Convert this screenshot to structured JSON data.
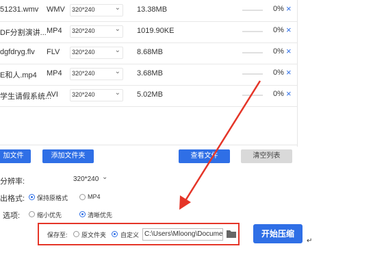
{
  "files": [
    {
      "name": "51231.wmv",
      "format": "WMV",
      "resolution": "320*240",
      "size": "13.38MB",
      "progress": 0,
      "progress_text": "0%"
    },
    {
      "name": "DF分割演讲...",
      "format": "MP4",
      "resolution": "320*240",
      "size": "1019.90KE",
      "progress": 0,
      "progress_text": "0%"
    },
    {
      "name": "dgfdryg.flv",
      "format": "FLV",
      "resolution": "320*240",
      "size": "8.68MB",
      "progress": 0,
      "progress_text": "0%"
    },
    {
      "name": "E和人.mp4",
      "format": "MP4",
      "resolution": "320*240",
      "size": "3.68MB",
      "progress": 0,
      "progress_text": "0%"
    },
    {
      "name": "学生请假系统...",
      "format": "AVI",
      "resolution": "320*240",
      "size": "5.02MB",
      "progress": 0,
      "progress_text": "0%"
    }
  ],
  "icons": {
    "delete": "close-icon",
    "folder": "folder-icon",
    "dropdown": "chevron-down-icon"
  },
  "colors": {
    "accent": "#2f6fe6",
    "highlight": "#e53528"
  },
  "toolbar": {
    "add_file": "加文件",
    "add_folder": "添加文件夹",
    "view_file": "查看文件",
    "clear_list": "清空列表"
  },
  "settings": {
    "resolution_label": "分辨率:",
    "resolution_value": "320*240",
    "output_format_label": "出格式:",
    "format_options": [
      "保持原格式",
      "MP4"
    ],
    "format_selected": "保持原格式",
    "option_label": "选项:",
    "quality_options": [
      "缩小优先",
      "清晰优先"
    ],
    "quality_selected": "清晰优先"
  },
  "save": {
    "label": "保存至:",
    "option_original": "原文件夹",
    "option_custom": "自定义",
    "selected": "自定义",
    "path": "C:\\Users\\Mloong\\Docume"
  },
  "start_button": "开始压缩"
}
